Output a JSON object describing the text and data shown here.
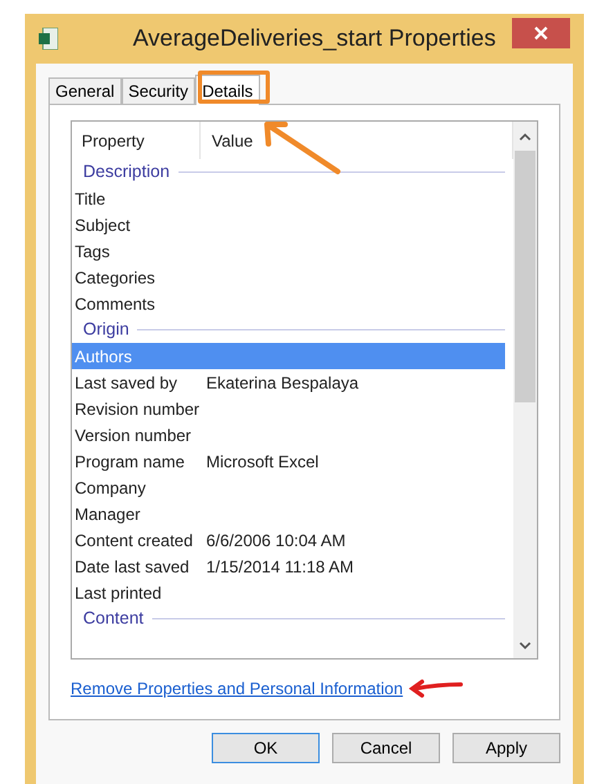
{
  "window": {
    "title": "AverageDeliveries_start Properties"
  },
  "tabs": [
    {
      "label": "General",
      "selected": false
    },
    {
      "label": "Security",
      "selected": false
    },
    {
      "label": "Details",
      "selected": true
    }
  ],
  "table": {
    "columns": [
      "Property",
      "Value"
    ],
    "rows": [
      {
        "kind": "group",
        "label": "Description"
      },
      {
        "kind": "item",
        "property": "Title",
        "selected": false
      },
      {
        "kind": "item",
        "property": "Subject",
        "selected": false
      },
      {
        "kind": "item",
        "property": "Tags",
        "selected": false
      },
      {
        "kind": "item",
        "property": "Categories",
        "selected": false
      },
      {
        "kind": "item",
        "property": "Comments",
        "selected": false
      },
      {
        "kind": "group",
        "label": "Origin"
      },
      {
        "kind": "item",
        "property": "Authors",
        "selected": true
      },
      {
        "kind": "item",
        "property": "Last saved by",
        "value": "Ekaterina Bespalaya",
        "selected": false
      },
      {
        "kind": "item",
        "property": "Revision number",
        "selected": false
      },
      {
        "kind": "item",
        "property": "Version number",
        "selected": false
      },
      {
        "kind": "item",
        "property": "Program name",
        "value": "Microsoft Excel",
        "selected": false
      },
      {
        "kind": "item",
        "property": "Company",
        "selected": false
      },
      {
        "kind": "item",
        "property": "Manager",
        "selected": false
      },
      {
        "kind": "item",
        "property": "Content created",
        "value": "6/6/2006 10:04 AM",
        "selected": false
      },
      {
        "kind": "item",
        "property": "Date last saved",
        "value": "1/15/2014 11:18 AM",
        "selected": false
      },
      {
        "kind": "item",
        "property": "Last printed",
        "selected": false
      },
      {
        "kind": "group",
        "label": "Content"
      }
    ]
  },
  "link": "Remove Properties and Personal Information",
  "buttons": [
    {
      "label": "OK",
      "default": true
    },
    {
      "label": "Cancel",
      "default": false
    },
    {
      "label": "Apply",
      "default": false
    }
  ]
}
